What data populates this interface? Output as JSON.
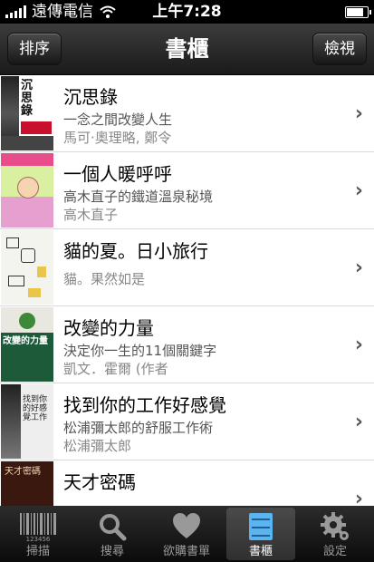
{
  "status_bar": {
    "carrier": "遠傳電信",
    "time": "上午7:28",
    "battery_level": 0.9
  },
  "navbar": {
    "title": "書櫃",
    "left_button": "排序",
    "right_button": "檢視"
  },
  "books": [
    {
      "title": "沉思錄",
      "line1": "一念之間改變人生",
      "line2": "馬可·奧理略, 鄭令",
      "cover_text": "沉思錄 一念之間改變人生"
    },
    {
      "title": "一個人暖呼呼",
      "line1": "高木直子的鐵道溫泉秘境",
      "line2": "高木直子",
      "cover_text": "一個人暖呼呼"
    },
    {
      "title": "貓的夏。日小旅行",
      "line1": "",
      "line2": "貓。果然如是",
      "cover_text": ""
    },
    {
      "title": "改變的力量",
      "line1": "決定你一生的11個關鍵字",
      "line2": "凱文．霍爾 (作者",
      "cover_text": "改變的力量"
    },
    {
      "title": "找到你的工作好感覺",
      "line1": "松浦彌太郎的舒服工作術",
      "line2": "松浦彌太郎",
      "cover_text": "找到你的工作好感覺"
    },
    {
      "title": "天才密碼",
      "line1": "",
      "line2": "",
      "cover_text": "天才密碼"
    }
  ],
  "tabs": [
    {
      "label": "掃描",
      "icon": "barcode-icon"
    },
    {
      "label": "搜尋",
      "icon": "search-icon"
    },
    {
      "label": "欲購書單",
      "icon": "heart-icon"
    },
    {
      "label": "書櫃",
      "icon": "bookshelf-icon",
      "active": true
    },
    {
      "label": "設定",
      "icon": "gear-icon"
    }
  ],
  "barcode_digits": "123456"
}
